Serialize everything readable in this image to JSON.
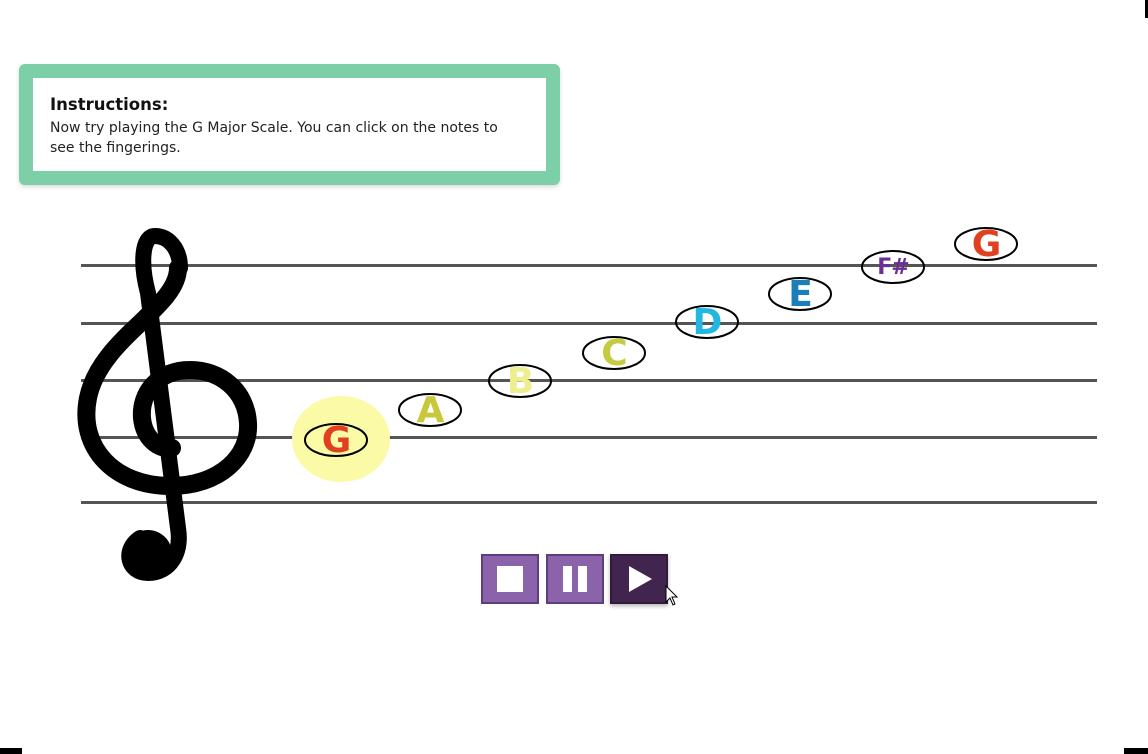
{
  "instructions": {
    "title": "Instructions:",
    "body": "Now try playing the G Major Scale. You can click on the notes to see the fingerings."
  },
  "colors": {
    "panel_border": "#7dcfa8",
    "staff": "#555555",
    "button": "#8a63ab",
    "button_active": "#42254f",
    "highlight": "#fbfaa6"
  },
  "notes": [
    {
      "label": "G",
      "color": "#e0401f",
      "highlighted": true
    },
    {
      "label": "A",
      "color": "#c7c83a",
      "highlighted": false
    },
    {
      "label": "B",
      "color": "#eeee90",
      "highlighted": false
    },
    {
      "label": "C",
      "color": "#c5cb3f",
      "highlighted": false
    },
    {
      "label": "D",
      "color": "#22b7e0",
      "highlighted": false
    },
    {
      "label": "E",
      "color": "#1a7fb8",
      "highlighted": false
    },
    {
      "label": "F#",
      "color": "#6b2f93",
      "highlighted": false
    },
    {
      "label": "G",
      "color": "#e0401f",
      "highlighted": false
    }
  ],
  "controls": {
    "stop_icon": "stop-icon",
    "pause_icon": "pause-icon",
    "play_icon": "play-icon",
    "active": "play"
  }
}
